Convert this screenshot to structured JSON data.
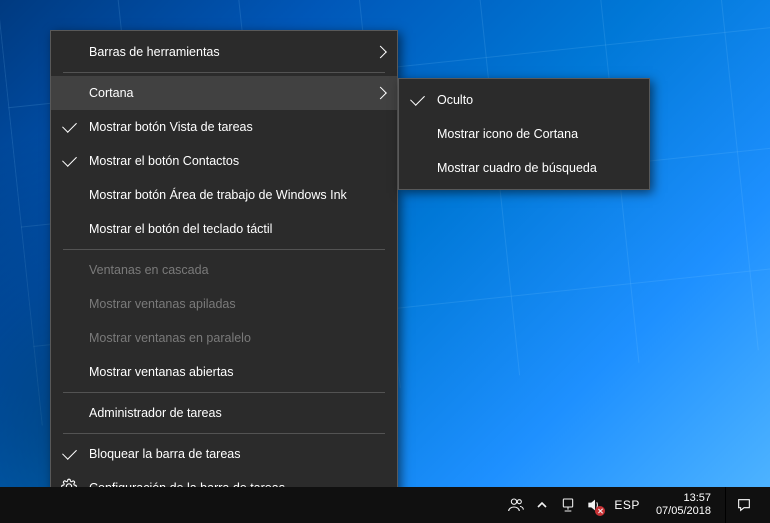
{
  "menu": {
    "items": [
      {
        "label": "Barras de herramientas",
        "submenu": true
      },
      {
        "label": "Cortana",
        "submenu": true,
        "hovered": true
      },
      {
        "label": "Mostrar botón Vista de tareas",
        "checked": true
      },
      {
        "label": "Mostrar el botón Contactos",
        "checked": true
      },
      {
        "label": "Mostrar botón Área de trabajo de Windows Ink"
      },
      {
        "label": "Mostrar el botón del teclado táctil"
      },
      {
        "label": "Ventanas en cascada",
        "disabled": true
      },
      {
        "label": "Mostrar ventanas apiladas",
        "disabled": true
      },
      {
        "label": "Mostrar ventanas en paralelo",
        "disabled": true
      },
      {
        "label": "Mostrar ventanas abiertas"
      },
      {
        "label": "Administrador de tareas"
      },
      {
        "label": "Bloquear la barra de tareas",
        "checked": true
      },
      {
        "label": "Configuración de la barra de tareas",
        "icon": "gear"
      }
    ]
  },
  "submenu": {
    "items": [
      {
        "label": "Oculto",
        "checked": true
      },
      {
        "label": "Mostrar icono de Cortana"
      },
      {
        "label": "Mostrar cuadro de búsqueda"
      }
    ]
  },
  "tray": {
    "language": "ESP",
    "time": "13:57",
    "date": "07/05/2018"
  }
}
